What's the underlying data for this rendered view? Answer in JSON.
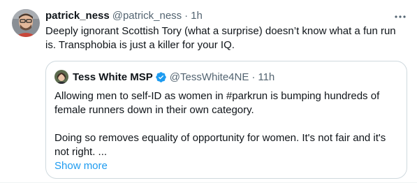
{
  "tweet": {
    "display_name": "patrick_ness",
    "handle": "@patrick_ness",
    "separator": "·",
    "time": "1h",
    "text": "Deeply ignorant Scottish Tory (what a surprise) doesn’t know what a fun run is. Transphobia is just a killer for your IQ."
  },
  "quoted_tweet": {
    "display_name": "Tess White MSP",
    "handle": "@TessWhite4NE",
    "separator": "·",
    "time": "11h",
    "paragraph_1": "Allowing men to self-ID as women in #parkrun is bumping hundreds of female runners down in their own category.",
    "paragraph_2": "Doing so removes equality of opportunity for women. It's not fair and it's not right. ...",
    "show_more": "Show more"
  },
  "icons": {
    "more": "more-horizontal-icon",
    "verified": "verified-badge-icon"
  },
  "colors": {
    "text": "#0f1419",
    "secondary": "#536471",
    "link": "#1d9bf0",
    "border": "#cfd9de",
    "verified": "#1d9bf0"
  }
}
